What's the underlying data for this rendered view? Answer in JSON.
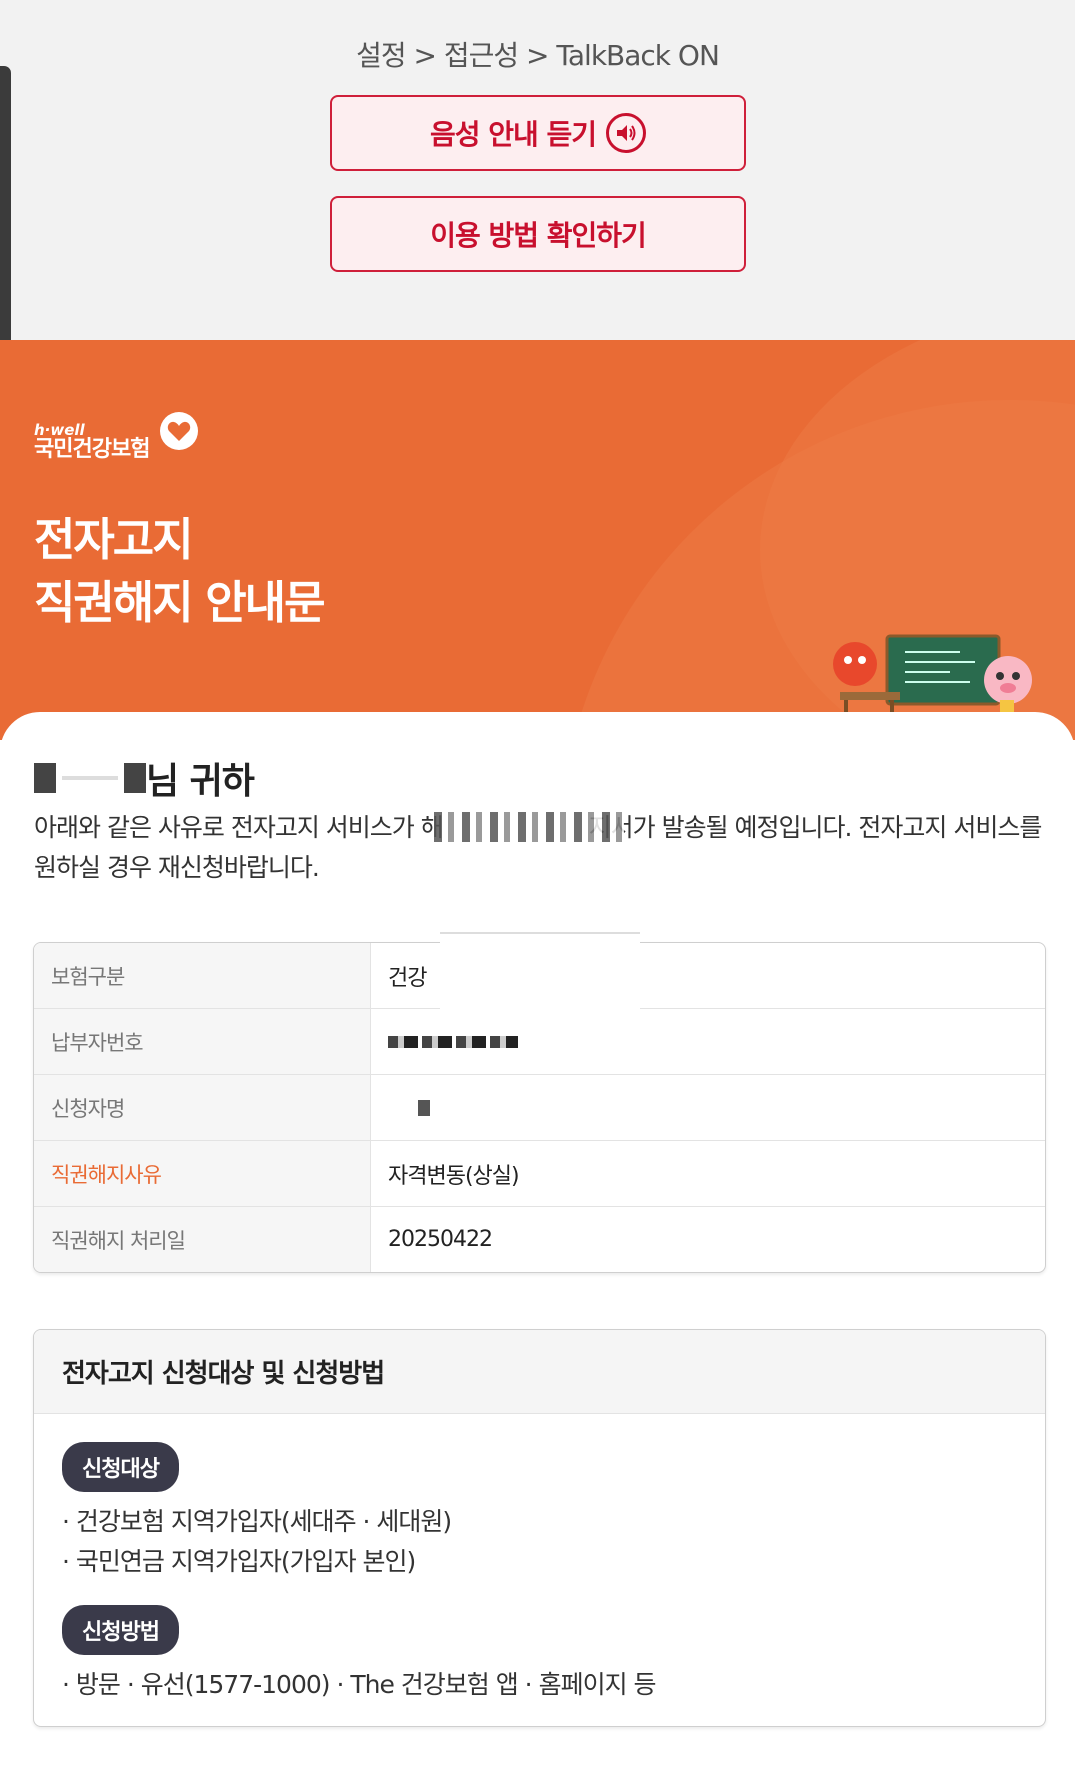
{
  "breadcrumb": "설정 > 접근성 > TalkBack ON",
  "buttons": {
    "listen_label": "음성 안내 듣기",
    "howto_label": "이용 방법 확인하기"
  },
  "brand": {
    "tagline": "h·well",
    "name": "국민건강보험"
  },
  "hero": {
    "title_line1": "전자고지",
    "title_line2": "직권해지 안내문"
  },
  "greeting": {
    "suffix": "님 귀하"
  },
  "description": {
    "part1": "아래와 같은 사유로 전자고지 서비스가 해",
    "part2": "지서가 발송될 예정입니다. 전자고지 서비스를 원하실 경우 재신청바랍니다."
  },
  "info_table": [
    {
      "key": "보험구분",
      "value": "건강"
    },
    {
      "key": "납부자번호",
      "value": ""
    },
    {
      "key": "신청자명",
      "value": ""
    },
    {
      "key": "직권해지사유",
      "value": "자격변동(상실)"
    },
    {
      "key": "직권해지 처리일",
      "value": "20250422"
    }
  ],
  "guide": {
    "title": "전자고지 신청대상 및 신청방법",
    "target_badge": "신청대상",
    "targets": [
      "· 건강보험 지역가입자(세대주 · 세대원)",
      "· 국민연금 지역가입자(가입자 본인)"
    ],
    "method_badge": "신청방법",
    "methods": [
      "· 방문 · 유선(1577-1000) · The 건강보험 앱 · 홈페이지 등"
    ]
  },
  "colors": {
    "accent_red": "#c8102e",
    "hero_orange": "#e96b35",
    "badge_dark": "#3a3a4a"
  }
}
